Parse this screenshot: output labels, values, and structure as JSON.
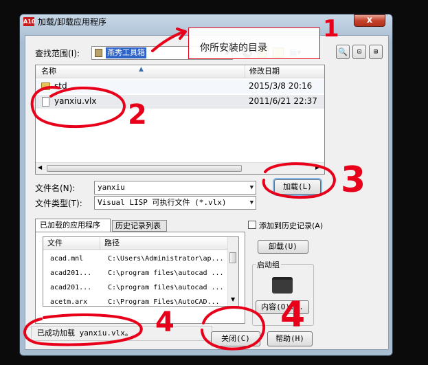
{
  "window": {
    "title": "加载/卸载应用程序",
    "close": "x",
    "app_icon": "A10"
  },
  "lookin": {
    "label": "查找范围(I):",
    "value": "燕秀工具箱"
  },
  "callout": {
    "text": "你所安装的目录"
  },
  "file_list": {
    "columns": [
      "名称",
      "修改日期"
    ],
    "rows": [
      {
        "name": "std",
        "date": "2015/3/8 20:16",
        "icon": "folder-icon"
      },
      {
        "name": "yanxiu.vlx",
        "date": "2011/6/21 22:37",
        "icon": "file-icon"
      }
    ]
  },
  "filename": {
    "label": "文件名(N):",
    "value": "yanxiu"
  },
  "filetype": {
    "label": "文件类型(T):",
    "value": "Visual LISP 可执行文件 (*.vlx)"
  },
  "load_button": "加载(L)",
  "tabs": [
    "已加载的应用程序",
    "历史记录列表"
  ],
  "add_history": "添加到历史记录(A)",
  "loaded_list": {
    "columns": [
      "文件",
      "路径"
    ],
    "rows": [
      {
        "file": "acad.mnl",
        "path": "C:\\Users\\Administrator\\ap..."
      },
      {
        "file": "acad201...",
        "path": "C:\\program files\\autocad ..."
      },
      {
        "file": "acad201...",
        "path": "C:\\program files\\autocad ..."
      },
      {
        "file": "acetm.arx",
        "path": "C:\\Program Files\\AutoCAD..."
      }
    ]
  },
  "unload_button": "卸载(U)",
  "startup": {
    "label": "启动组",
    "button": "内容(O)..."
  },
  "status": "已成功加载 yanxiu.vlx。",
  "close_button": "关闭(C)",
  "help_button": "帮助(H)",
  "annotations": {
    "n1": "1",
    "n2": "2",
    "n3": "3",
    "n4a": "4",
    "n4b": "4"
  },
  "colors": {
    "annotation": "#e8001a",
    "accent": "#cde3f6"
  }
}
